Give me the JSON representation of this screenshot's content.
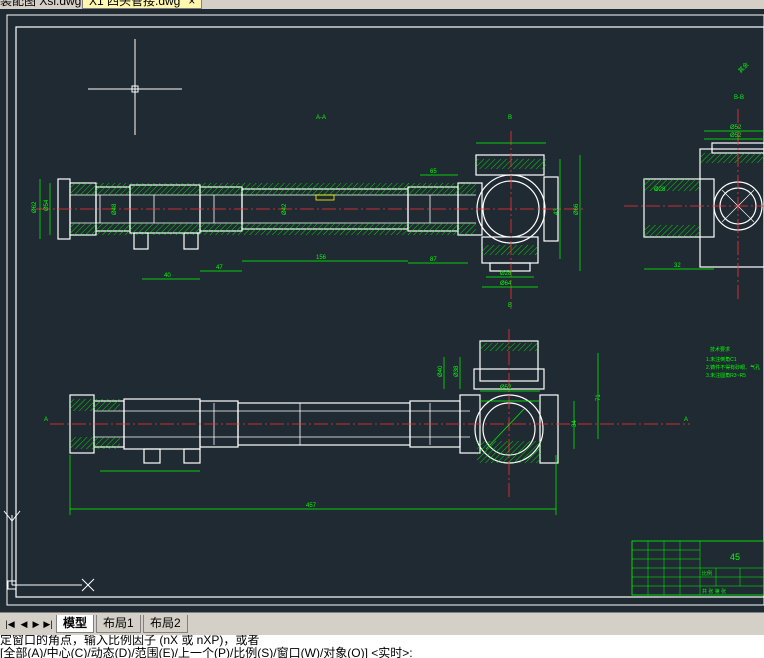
{
  "document_tabs": [
    {
      "label": "装配图 Xsl.dwg",
      "active": false
    },
    {
      "label": "X1 四头管接.dwg",
      "active": true
    }
  ],
  "drawing": {
    "section_label_top": "A-A",
    "section_label_right": "B-B",
    "section_marker_b": "B",
    "section_marker_a": "A",
    "roughness_note": "其余",
    "notes_title": "技术要求",
    "notes_lines": [
      "1.未注倒角C1",
      "2.铸件不得有砂眼、气孔",
      "3.未注圆角R3~R5"
    ],
    "dims": {
      "d1": "Ø62",
      "d2": "Ø54",
      "d3": "Ø48",
      "d4": "Ø42",
      "d5": "40",
      "d6": "47",
      "d7": "156",
      "d8": "87",
      "d9": "Ø28",
      "d10": "Ø64",
      "d11": "65",
      "d12": "Ø66",
      "d13": "43",
      "d14": "Ø28",
      "d15": "Ø52",
      "d16": "Ø52",
      "d17": "71",
      "d18": "32",
      "d19": "34",
      "d20": "Ø40",
      "d21": "Ø38",
      "d22": "457"
    },
    "title_block": {
      "material": "45",
      "scale_label": "比例",
      "sheet_label": "共 张 第 张"
    },
    "ucs_labels": {
      "y": "Y",
      "x": "X"
    }
  },
  "layout_bar": {
    "nav_buttons": [
      "◀",
      "▶",
      "▶|"
    ],
    "first_button": "|◀",
    "tabs": [
      {
        "label": "模型",
        "active": true
      },
      {
        "label": "布局1",
        "active": false
      },
      {
        "label": "布局2",
        "active": false
      }
    ]
  },
  "command": {
    "line1": "定窗口的角点，输入比例因子 (nX 或 nXP)，或者",
    "line2": "[全部(A)/中心(C)/动态(D)/范围(E)/上一个(P)/比例(S)/窗口(W)/对象(O)] <实时>:"
  },
  "colors": {
    "background": "#1f2a33",
    "outline": "#ffffff",
    "dimension": "#00ff00",
    "center": "#ff3030",
    "hatch": "#00ff00",
    "accent": "#ffff00"
  }
}
